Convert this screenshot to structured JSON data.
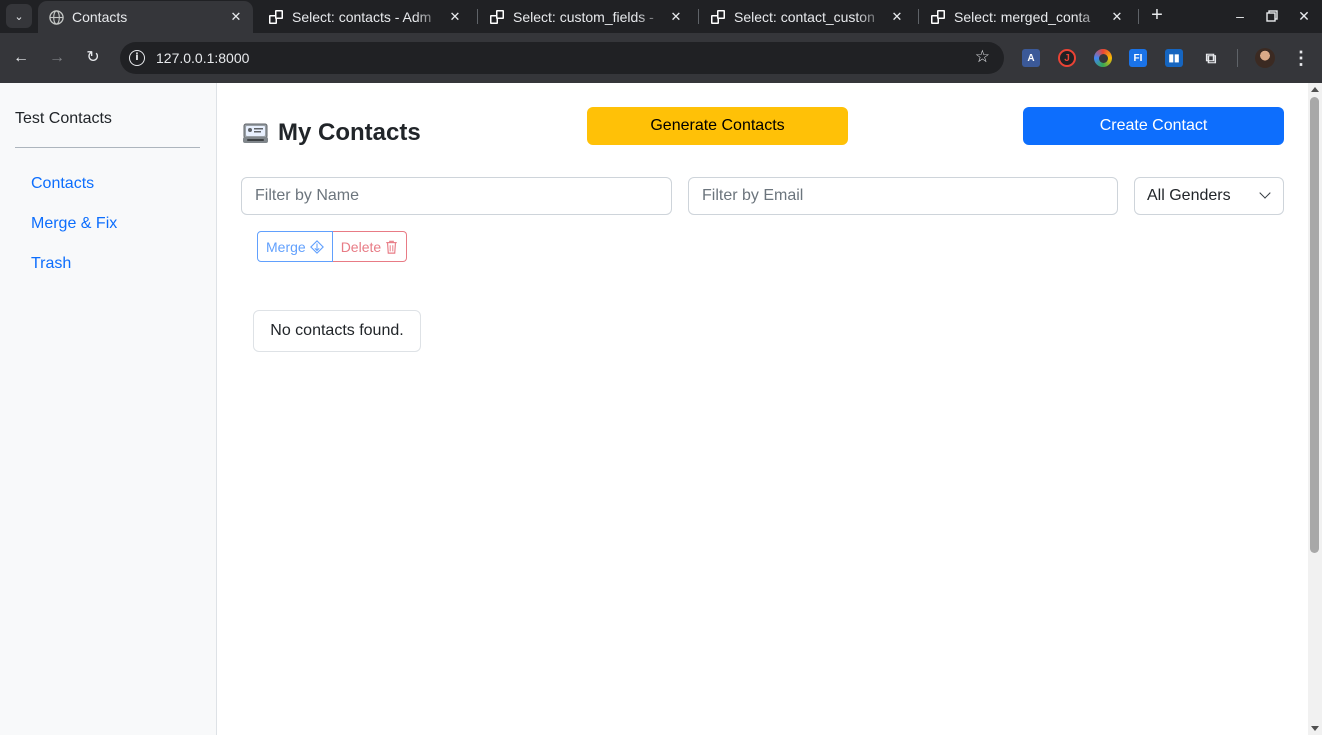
{
  "browser": {
    "tabs": [
      {
        "title": "Contacts",
        "active": true
      },
      {
        "title": "Select: contacts - Adm",
        "active": false
      },
      {
        "title": "Select: custom_fields -",
        "active": false
      },
      {
        "title": "Select: contact_custon",
        "active": false
      },
      {
        "title": "Select: merged_conta",
        "active": false
      }
    ],
    "new_tab": "+",
    "url": "127.0.0.1:8000",
    "colors": {
      "tabbar": "#202124",
      "toolbar": "#35363a",
      "omnibox": "#202124"
    }
  },
  "sidebar": {
    "brand": "Test Contacts",
    "items": [
      {
        "label": "Contacts"
      },
      {
        "label": "Merge & Fix"
      },
      {
        "label": "Trash"
      }
    ]
  },
  "main": {
    "title": "My Contacts",
    "title_icon": "card-index-icon",
    "generate_label": "Generate Contacts",
    "create_label": "Create Contact",
    "filter_name_placeholder": "Filter by Name",
    "filter_email_placeholder": "Filter by Email",
    "gender_select_value": "All Genders",
    "merge_label": "Merge",
    "merge_icon": "merge-icon",
    "delete_label": "Delete",
    "delete_icon": "trash-icon",
    "empty_message": "No contacts found."
  },
  "colors": {
    "primary": "#0d6efd",
    "warning": "#ffc107",
    "danger": "#dc3545",
    "sidebar_bg": "#f8f9fa"
  }
}
